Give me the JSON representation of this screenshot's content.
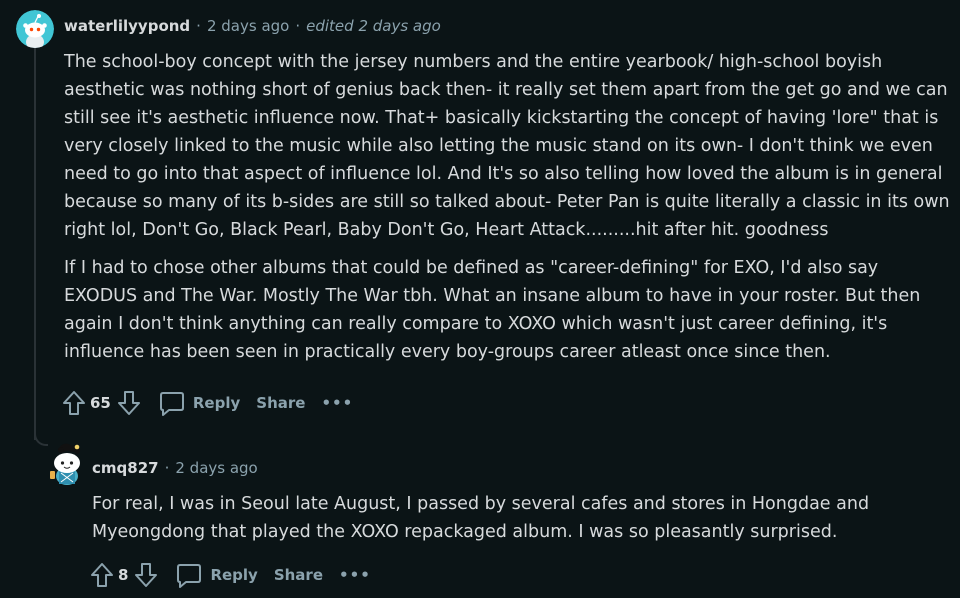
{
  "comments": [
    {
      "author": "waterlilyypond",
      "separator": "·",
      "time": "2 days ago",
      "edited": "edited 2 days ago",
      "paragraphs": [
        "The school-boy concept with the jersey numbers and the entire yearbook/ high-school boyish aesthetic was nothing short of genius back then- it really set them apart from the get go and we can still see it's aesthetic influence now. That+ basically kickstarting the concept of having 'lore\" that is very closely linked to the music while also letting the music stand on its own- I don't think we even need to go into that aspect of influence lol. And It's so also telling how loved the album is in general because so many of its b-sides are still so talked about- Peter Pan is quite literally a classic in its own right lol, Don't Go, Black Pearl, Baby Don't Go, Heart Attack.........hit after hit. goodness",
        "If I had to chose other albums that could be defined as \"career-defining\" for EXO, I'd also say EXODUS and The War. Mostly The War tbh. What an insane album to have in your roster. But then again I don't think anything can really compare to XOXO which wasn't just career defining, it's influence has been seen in practically every boy-groups career atleast once since then."
      ],
      "votes": "65",
      "reply_label": "Reply",
      "share_label": "Share",
      "more_label": "•••"
    },
    {
      "author": "cmq827",
      "separator": "·",
      "time": "2 days ago",
      "paragraphs": [
        "For real, I was in Seoul late August, I passed by several cafes and stores in Hongdae and Myeongdong that played the XOXO repackaged album. I was so pleasantly surprised."
      ],
      "votes": "8",
      "reply_label": "Reply",
      "share_label": "Share",
      "more_label": "•••"
    }
  ],
  "colors": {
    "background": "#0b1416",
    "text": "#d7dadc",
    "meta": "#8ba2ad",
    "avatar1": "#41c6d5",
    "thread_line": "#2a3236"
  }
}
